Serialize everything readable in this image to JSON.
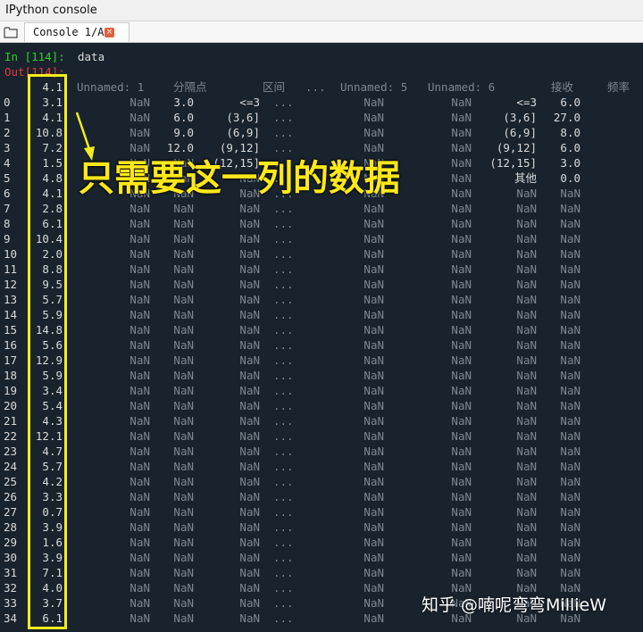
{
  "window": {
    "title": "IPython console"
  },
  "tabs": [
    {
      "label": "Console 1/A",
      "close_glyph": "×"
    }
  ],
  "console": {
    "input_prompt": "In [114]:",
    "input_code": "data",
    "output_prompt": "Out[114]:",
    "header": [
      "4.1",
      "Unnamed: 1",
      "分隔点",
      "区间",
      "...",
      "Unnamed: 5",
      "Unnamed: 6",
      "接收",
      "频率"
    ],
    "rows": [
      [
        "0",
        "3.1",
        "NaN",
        "3.0",
        "<=3",
        "...",
        "NaN",
        "NaN",
        "<=3",
        "6.0"
      ],
      [
        "1",
        "4.1",
        "NaN",
        "6.0",
        "(3,6]",
        "...",
        "NaN",
        "NaN",
        "(3,6]",
        "27.0"
      ],
      [
        "2",
        "10.8",
        "NaN",
        "9.0",
        "(6,9]",
        "...",
        "NaN",
        "NaN",
        "(6,9]",
        "8.0"
      ],
      [
        "3",
        "7.2",
        "NaN",
        "12.0",
        "(9,12]",
        "...",
        "NaN",
        "NaN",
        "(9,12]",
        "6.0"
      ],
      [
        "4",
        "1.5",
        "NaN",
        "NaN",
        "(12,15]",
        "...",
        "NaN",
        "NaN",
        "(12,15]",
        "3.0"
      ],
      [
        "5",
        "4.8",
        "NaN",
        "NaN",
        "NaN",
        "...",
        "NaN",
        "NaN",
        "其他",
        "0.0"
      ],
      [
        "6",
        "4.1",
        "NaN",
        "NaN",
        "NaN",
        "...",
        "NaN",
        "NaN",
        "NaN",
        "NaN"
      ],
      [
        "7",
        "2.8",
        "NaN",
        "NaN",
        "NaN",
        "...",
        "NaN",
        "NaN",
        "NaN",
        "NaN"
      ],
      [
        "8",
        "6.1",
        "NaN",
        "NaN",
        "NaN",
        "...",
        "NaN",
        "NaN",
        "NaN",
        "NaN"
      ],
      [
        "9",
        "10.4",
        "NaN",
        "NaN",
        "NaN",
        "...",
        "NaN",
        "NaN",
        "NaN",
        "NaN"
      ],
      [
        "10",
        "2.0",
        "NaN",
        "NaN",
        "NaN",
        "...",
        "NaN",
        "NaN",
        "NaN",
        "NaN"
      ],
      [
        "11",
        "8.8",
        "NaN",
        "NaN",
        "NaN",
        "...",
        "NaN",
        "NaN",
        "NaN",
        "NaN"
      ],
      [
        "12",
        "9.5",
        "NaN",
        "NaN",
        "NaN",
        "...",
        "NaN",
        "NaN",
        "NaN",
        "NaN"
      ],
      [
        "13",
        "5.7",
        "NaN",
        "NaN",
        "NaN",
        "...",
        "NaN",
        "NaN",
        "NaN",
        "NaN"
      ],
      [
        "14",
        "5.9",
        "NaN",
        "NaN",
        "NaN",
        "...",
        "NaN",
        "NaN",
        "NaN",
        "NaN"
      ],
      [
        "15",
        "14.8",
        "NaN",
        "NaN",
        "NaN",
        "...",
        "NaN",
        "NaN",
        "NaN",
        "NaN"
      ],
      [
        "16",
        "5.6",
        "NaN",
        "NaN",
        "NaN",
        "...",
        "NaN",
        "NaN",
        "NaN",
        "NaN"
      ],
      [
        "17",
        "12.9",
        "NaN",
        "NaN",
        "NaN",
        "...",
        "NaN",
        "NaN",
        "NaN",
        "NaN"
      ],
      [
        "18",
        "5.9",
        "NaN",
        "NaN",
        "NaN",
        "...",
        "NaN",
        "NaN",
        "NaN",
        "NaN"
      ],
      [
        "19",
        "3.4",
        "NaN",
        "NaN",
        "NaN",
        "...",
        "NaN",
        "NaN",
        "NaN",
        "NaN"
      ],
      [
        "20",
        "5.4",
        "NaN",
        "NaN",
        "NaN",
        "...",
        "NaN",
        "NaN",
        "NaN",
        "NaN"
      ],
      [
        "21",
        "4.3",
        "NaN",
        "NaN",
        "NaN",
        "...",
        "NaN",
        "NaN",
        "NaN",
        "NaN"
      ],
      [
        "22",
        "12.1",
        "NaN",
        "NaN",
        "NaN",
        "...",
        "NaN",
        "NaN",
        "NaN",
        "NaN"
      ],
      [
        "23",
        "4.7",
        "NaN",
        "NaN",
        "NaN",
        "...",
        "NaN",
        "NaN",
        "NaN",
        "NaN"
      ],
      [
        "24",
        "5.7",
        "NaN",
        "NaN",
        "NaN",
        "...",
        "NaN",
        "NaN",
        "NaN",
        "NaN"
      ],
      [
        "25",
        "4.2",
        "NaN",
        "NaN",
        "NaN",
        "...",
        "NaN",
        "NaN",
        "NaN",
        "NaN"
      ],
      [
        "26",
        "3.3",
        "NaN",
        "NaN",
        "NaN",
        "...",
        "NaN",
        "NaN",
        "NaN",
        "NaN"
      ],
      [
        "27",
        "0.7",
        "NaN",
        "NaN",
        "NaN",
        "...",
        "NaN",
        "NaN",
        "NaN",
        "NaN"
      ],
      [
        "28",
        "3.9",
        "NaN",
        "NaN",
        "NaN",
        "...",
        "NaN",
        "NaN",
        "NaN",
        "NaN"
      ],
      [
        "29",
        "1.6",
        "NaN",
        "NaN",
        "NaN",
        "...",
        "NaN",
        "NaN",
        "NaN",
        "NaN"
      ],
      [
        "30",
        "3.9",
        "NaN",
        "NaN",
        "NaN",
        "...",
        "NaN",
        "NaN",
        "NaN",
        "NaN"
      ],
      [
        "31",
        "7.1",
        "NaN",
        "NaN",
        "NaN",
        "...",
        "NaN",
        "NaN",
        "NaN",
        "NaN"
      ],
      [
        "32",
        "4.0",
        "NaN",
        "NaN",
        "NaN",
        "...",
        "NaN",
        "NaN",
        "NaN",
        "NaN"
      ],
      [
        "33",
        "3.7",
        "NaN",
        "NaN",
        "NaN",
        "...",
        "NaN",
        "NaN",
        "NaN",
        "NaN"
      ],
      [
        "34",
        "6.1",
        "NaN",
        "NaN",
        "NaN",
        "...",
        "NaN",
        "NaN",
        "NaN",
        "NaN"
      ]
    ]
  },
  "annotation": {
    "callout_text": "只需要这一列的数据"
  },
  "watermark": {
    "text": "知乎 @喃呢弯弯MillieW"
  },
  "colors": {
    "console_bg": "#19232d",
    "highlight": "#f4ec1c",
    "prompt_in": "#2fd12f",
    "prompt_out": "#e23a3a"
  }
}
